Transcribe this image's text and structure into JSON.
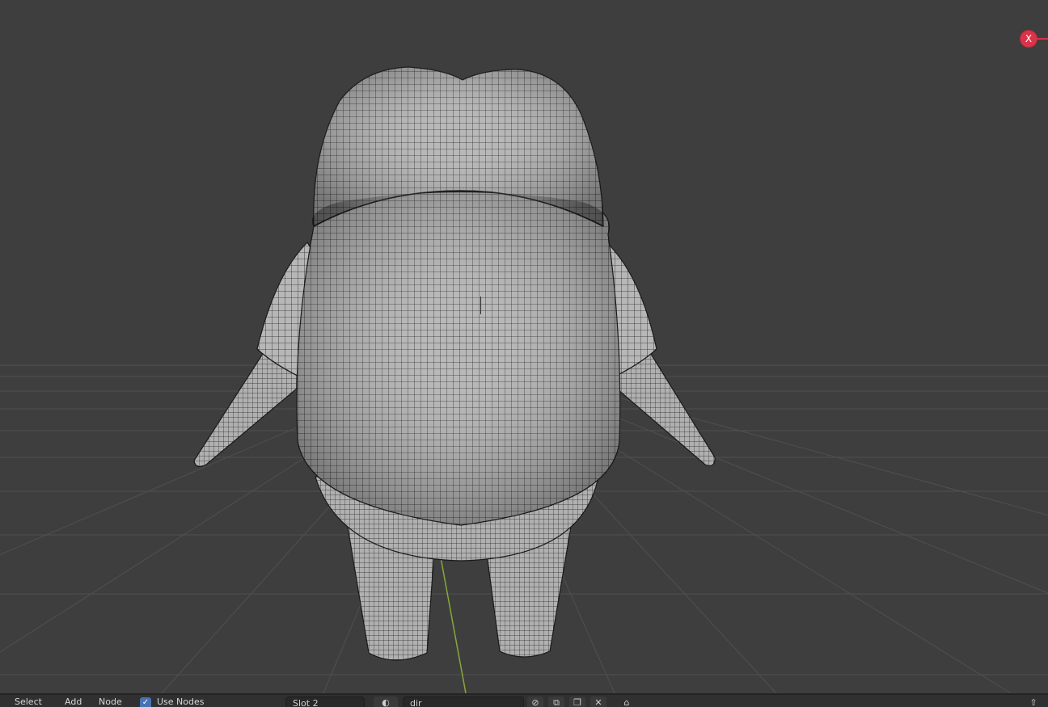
{
  "viewport": {
    "name": "3D Viewport",
    "gizmo": {
      "x_axis_label": "X",
      "x_color": "#d9344a"
    },
    "colors": {
      "background": "#3e3e3e",
      "grid": "#4e4e4e",
      "y_axis": "#86a83b",
      "mesh_fill": "#b5b5b5",
      "wire": "#202020"
    }
  },
  "header": {
    "menus": [
      "Select",
      "Add",
      "Node"
    ],
    "use_nodes_label": "Use Nodes",
    "use_nodes_checked": true,
    "slot_field": "Slot 2",
    "material_field": "dir",
    "icons": [
      "material-sphere-icon",
      "fake-user-icon",
      "new-material-icon",
      "delete-material-icon",
      "pin-icon",
      "expand-icon"
    ]
  }
}
